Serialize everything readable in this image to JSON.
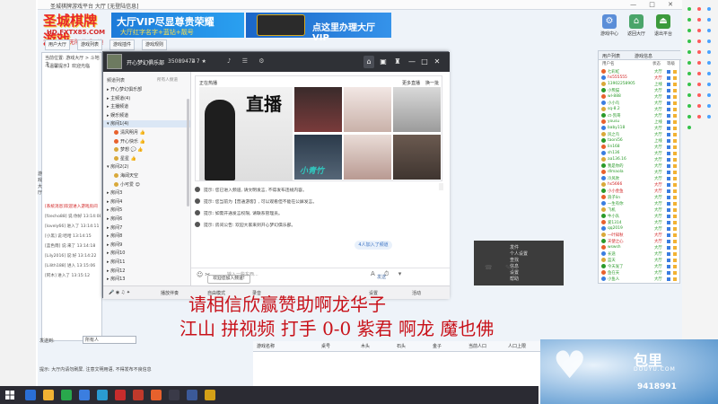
{
  "window": {
    "title": "圣城棋牌游戏平台 大厅 [无登陆信息]",
    "controls": "— □ ✕"
  },
  "logo": {
    "main": "圣城棋牌游戏",
    "url": "HD.FXTX85.COM",
    "slogan": "2013 精彩无限 快乐无边"
  },
  "banners": {
    "vip_title": "大厅VIP尽显尊贵荣耀",
    "vip_sub": "大厅红字名字+蓝钻+靓号",
    "vip_cta": "点这里办理大厅VIP"
  },
  "top_tools": [
    {
      "label": "游戏中心",
      "icon": "gear-icon",
      "color": "#5b8ed8"
    },
    {
      "label": "返回大厅",
      "icon": "home-icon",
      "color": "#4aa56a"
    },
    {
      "label": "退出平台",
      "icon": "exit-icon",
      "color": "#3c9a3c"
    }
  ],
  "hall_tabs": [
    "用户大厅",
    "游戏列表",
    "游戏插件",
    "游戏规则"
  ],
  "hall_left": {
    "location": "当前位置: 游戏大厅 > 斗地主",
    "notice": "【温馨提示】欢迎光临"
  },
  "chat_lines": [
    {
      "text": "[系统消息]欢迎进入游戏房间",
      "red": true
    },
    {
      "text": "[fzecho88] 说:你好 13:14:08",
      "red": false
    },
    {
      "text": "[lovely66] 进入了 13:14:11",
      "red": false
    },
    {
      "text": "[小黑] 说:哈哈 13:14:15",
      "red": false
    },
    {
      "text": "[蓝色雨] 说:来了 13:14:18",
      "red": false
    },
    {
      "text": "[Lily2016] 说:好 13:14:22",
      "red": false
    },
    {
      "text": "[Lilith188] 进入 13:15:06",
      "red": false
    },
    {
      "text": "[阿木] 进入了 13:15:12",
      "red": false
    }
  ],
  "side_vertical": "游戏大厅",
  "bottom_bar": {
    "label": "发送到:",
    "target": "所有人",
    "hint": "提示: 大厅内请勿刷屏, 注意文明用语, 不得发布不良信息"
  },
  "grid_columns": [
    "游戏名称",
    "桌号",
    "木头",
    "石头",
    "金子",
    "当前人口",
    "人口上限"
  ],
  "user_panel": {
    "tabs": [
      "用户列表",
      "游戏信息"
    ],
    "headers": [
      "用户名",
      "状态",
      "等级"
    ],
    "users": [
      {
        "name": "七彩虹",
        "status": "大厅",
        "color": "#2a9a2a"
      },
      {
        "name": "hs555555",
        "status": "大厅",
        "color": "#d02020"
      },
      {
        "name": "13902258905",
        "status": "上线",
        "color": "#2a9a2a"
      },
      {
        "name": "小熊猫",
        "status": "大厅",
        "color": "#2a9a2a"
      },
      {
        "name": "wl-888",
        "status": "大厅",
        "color": "#2a9a2a"
      },
      {
        "name": "小小鸟",
        "status": "大厅",
        "color": "#2a9a2a"
      },
      {
        "name": "sq-8.2",
        "status": "大厅",
        "color": "#2a9a2a"
      },
      {
        "name": "ct-凯哥",
        "status": "大厅",
        "color": "#2a9a2a"
      },
      {
        "name": "yousu",
        "status": "上线",
        "color": "#2a9a2a"
      },
      {
        "name": "baby118",
        "status": "大厅",
        "color": "#2a9a2a"
      },
      {
        "name": "风之鸟",
        "status": "大厅",
        "color": "#2a9a2a"
      },
      {
        "name": "taoni56",
        "status": "上线",
        "color": "#2a9a2a"
      },
      {
        "name": "lin168",
        "status": "大厅",
        "color": "#2a9a2a"
      },
      {
        "name": "sh136",
        "status": "大厅",
        "color": "#2a9a2a"
      },
      {
        "name": "aa136.16",
        "status": "大厅",
        "color": "#2a9a2a"
      },
      {
        "name": "我是你的",
        "status": "大厅",
        "color": "#2a9a2a"
      },
      {
        "name": "dlmaola",
        "status": "大厅",
        "color": "#2a9a2a"
      },
      {
        "name": "冷风吹",
        "status": "大厅",
        "color": "#2a9a2a"
      },
      {
        "name": "hs5666",
        "status": "大厅",
        "color": "#d02020"
      },
      {
        "name": "小小金鱼",
        "status": "大厅",
        "color": "#d02020"
      },
      {
        "name": "浪子lin",
        "status": "大厅",
        "color": "#2a9a2a"
      },
      {
        "name": "一生有你",
        "status": "大厅",
        "color": "#2a9a2a"
      },
      {
        "name": "飞机",
        "status": "大厅",
        "color": "#2a9a2a"
      },
      {
        "name": "牛小队",
        "status": "大厅",
        "color": "#2a9a2a"
      },
      {
        "name": "爱1314",
        "status": "大厅",
        "color": "#2a9a2a"
      },
      {
        "name": "qq2019",
        "status": "大厅",
        "color": "#2a9a2a"
      },
      {
        "name": "一叶知秋",
        "status": "大厅",
        "color": "#d02020"
      },
      {
        "name": "天使之心",
        "status": "大厅",
        "color": "#d02020"
      },
      {
        "name": "wswsh",
        "status": "大厅",
        "color": "#2a9a2a"
      },
      {
        "name": "长途",
        "status": "大厅",
        "color": "#2a9a2a"
      },
      {
        "name": "蓝天",
        "status": "大厅",
        "color": "#2a9a2a"
      },
      {
        "name": "今天发了",
        "status": "大厅",
        "color": "#2a9a2a"
      },
      {
        "name": "鱼在天",
        "status": "大厅",
        "color": "#2a9a2a"
      },
      {
        "name": "小鱼人",
        "status": "大厅",
        "color": "#2a9a2a"
      }
    ]
  },
  "dark_dialog": {
    "items": [
      "发件",
      "个人设置",
      "查找",
      "信息",
      "设置",
      "帮助"
    ]
  },
  "chat_window": {
    "room_name": "开心梦幻俱乐部",
    "room_id": "35089474",
    "stats": "1 7 ★",
    "sidebar": {
      "head_left": "频道列表",
      "head_right": "所有人频道",
      "groups": [
        {
          "label": "▸ 开心梦幻俱乐部",
          "indent": 0,
          "selected": false,
          "dot": ""
        },
        {
          "label": "▸ 主频道(4)",
          "indent": 0,
          "selected": false,
          "dot": ""
        },
        {
          "label": "▸ 主播频道",
          "indent": 0,
          "selected": false,
          "dot": ""
        },
        {
          "label": "▸ 娱乐频道",
          "indent": 0,
          "selected": false,
          "dot": ""
        },
        {
          "label": "▾ 房间1(4)",
          "indent": 0,
          "selected": true,
          "dot": ""
        },
        {
          "label": "清风明月 👍",
          "indent": 8,
          "selected": false,
          "dot": "#e8612c"
        },
        {
          "label": "开心快乐 👍",
          "indent": 8,
          "selected": false,
          "dot": "#e8612c"
        },
        {
          "label": "梦想 💬 👍",
          "indent": 8,
          "selected": false,
          "dot": "#d9a93a"
        },
        {
          "label": "星星 👍",
          "indent": 8,
          "selected": false,
          "dot": "#d9a93a"
        },
        {
          "label": "▾ 房间2(2)",
          "indent": 0,
          "selected": false,
          "dot": ""
        },
        {
          "label": "海阔天空",
          "indent": 8,
          "selected": false,
          "dot": "#d9a93a"
        },
        {
          "label": "小可爱 😊",
          "indent": 8,
          "selected": false,
          "dot": "#d9a93a"
        },
        {
          "label": "▸ 房间3",
          "indent": 0,
          "selected": false,
          "dot": ""
        },
        {
          "label": "▸ 房间4",
          "indent": 0,
          "selected": false,
          "dot": ""
        },
        {
          "label": "▸ 房间5",
          "indent": 0,
          "selected": false,
          "dot": ""
        },
        {
          "label": "▸ 房间6",
          "indent": 0,
          "selected": false,
          "dot": ""
        },
        {
          "label": "▸ 房间7",
          "indent": 0,
          "selected": false,
          "dot": ""
        },
        {
          "label": "▸ 房间8",
          "indent": 0,
          "selected": false,
          "dot": ""
        },
        {
          "label": "▸ 房间9",
          "indent": 0,
          "selected": false,
          "dot": ""
        },
        {
          "label": "▸ 房间10",
          "indent": 0,
          "selected": false,
          "dot": ""
        },
        {
          "label": "▸ 房间11",
          "indent": 0,
          "selected": false,
          "dot": ""
        },
        {
          "label": "▸ 房间12",
          "indent": 0,
          "selected": false,
          "dot": ""
        },
        {
          "label": "▸ 房间13",
          "indent": 0,
          "selected": false,
          "dot": ""
        }
      ]
    },
    "live": {
      "title": "正在热播",
      "more": "更多直播",
      "refresh": "换一批",
      "poster_text": "直播",
      "thumb_caption": "小青竹"
    },
    "system_messages": [
      "提示: 您已进入频道, 请文明发言, 不得发布违规内容。",
      "提示: 您当前为【普通游客】, 可以观看但不能在公屏发言。",
      "提示: 如需开通发言权限, 请联系管理员。",
      "提示: 房间公告: 欢迎大家来到开心梦幻俱乐部。"
    ],
    "welcome_button": "欢迎您加入频道!",
    "join_count": "4人加入了频道",
    "input_placeholder": "输入一些东西...",
    "send_label": "发送",
    "bottom_items": [
      "播放伴奏",
      "自由模式",
      "录音",
      "设置",
      "活动"
    ]
  },
  "overlay": {
    "line1": "请相信欣赢赞助啊龙华子",
    "line2": "江山 拼视频 打手 0-0 紫君 啊龙 魔也佛"
  },
  "watermark": {
    "brand": "包里",
    "sub": "DOUYU.COM",
    "room": "9418991"
  },
  "colors": {
    "accent_red": "#c8121a",
    "hall_blue": "#1d7bd9",
    "online_green": "#2a9a2a"
  }
}
